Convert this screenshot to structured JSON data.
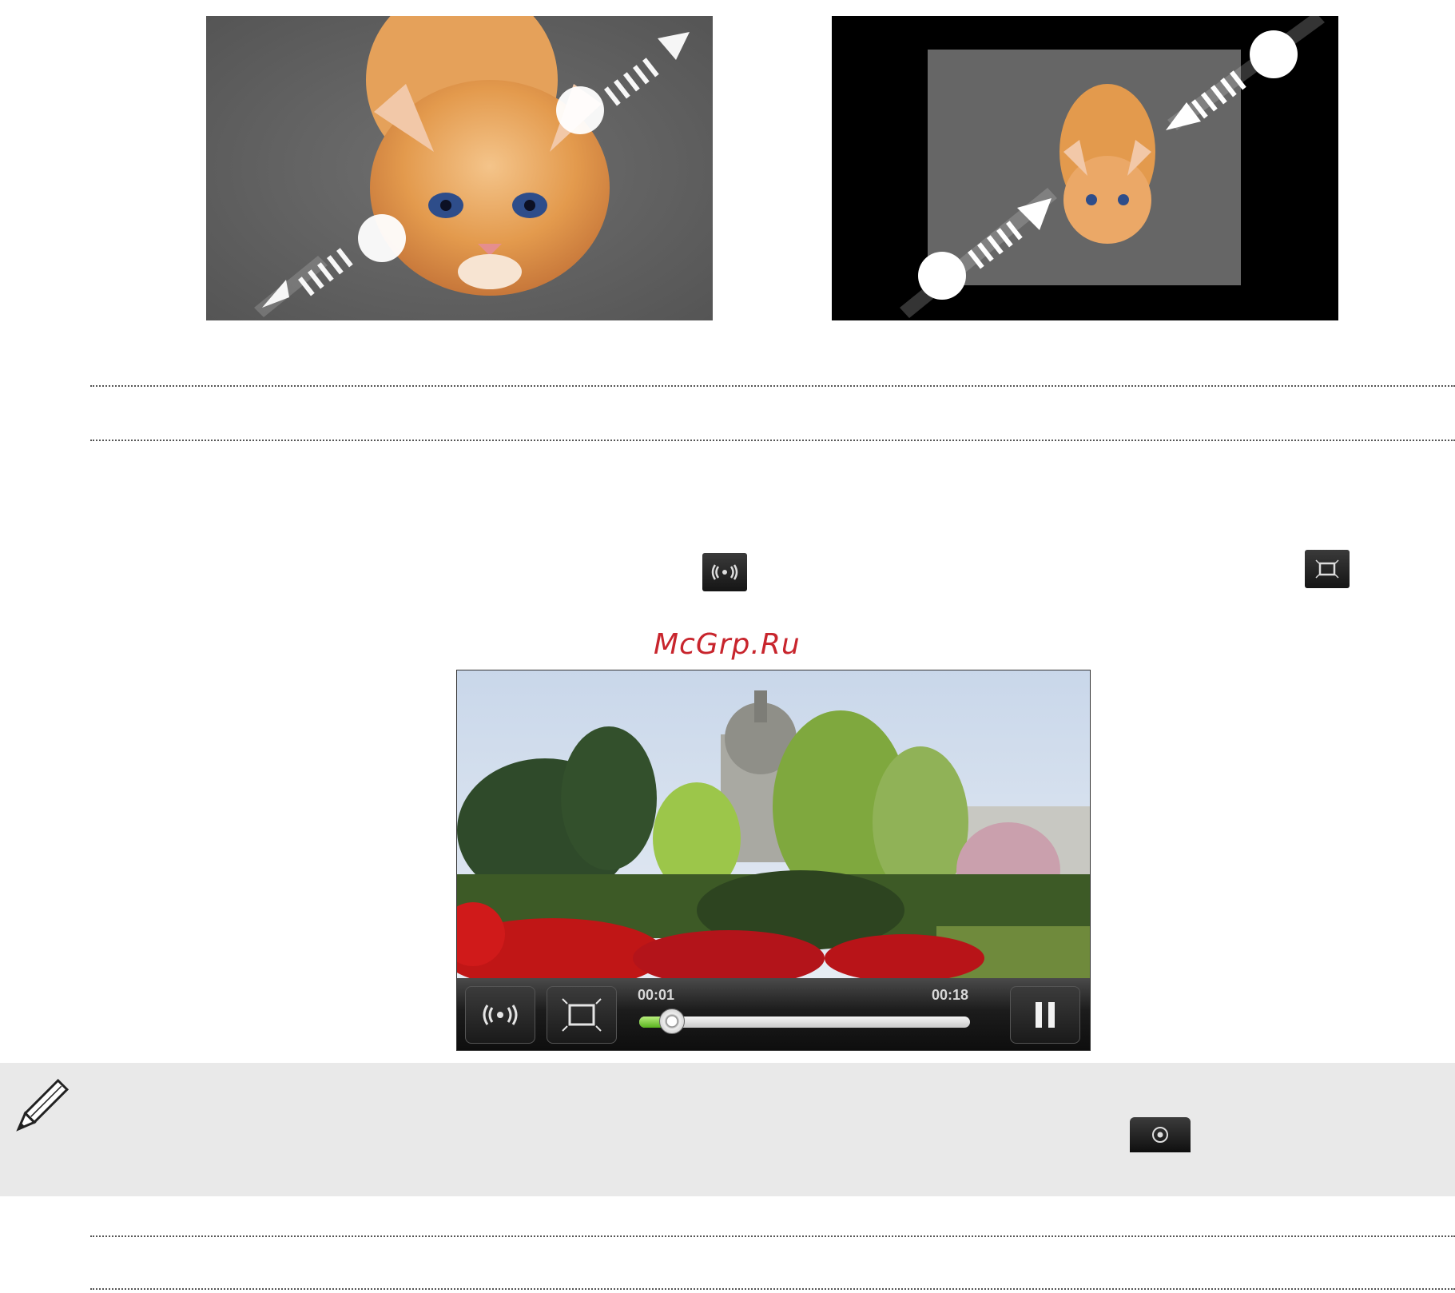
{
  "figures": {
    "zoom_in": {
      "icon": "pinch-zoom-out-arrows"
    },
    "zoom_out": {
      "icon": "pinch-zoom-in-arrows"
    }
  },
  "inline_icons": {
    "sound": "surround-sound-icon",
    "screen_size": "full-screen-icon",
    "camera_key": "camera-shutter-icon"
  },
  "watermark": "McGrp.Ru",
  "player": {
    "current_time": "00:01",
    "total_time": "00:18",
    "progress": 0.06,
    "buttons": [
      "surround-sound-icon",
      "full-screen-icon",
      "pause-icon"
    ]
  },
  "note": {
    "icon": "pencil-icon"
  },
  "colors": {
    "accent": "#6fc32a",
    "note_bg": "#e9e9e9",
    "watermark": "#c8252d"
  }
}
